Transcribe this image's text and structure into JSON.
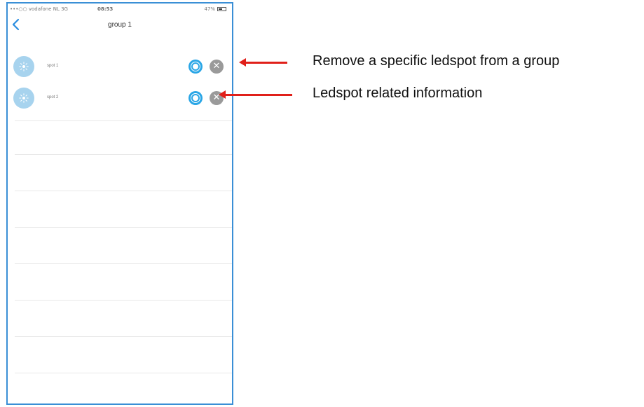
{
  "status_bar": {
    "carrier": "•••○○ vodafone NL  3G",
    "time": "08:53",
    "battery": "47%"
  },
  "nav": {
    "title": "group 1",
    "back_icon": "chevron-left-icon"
  },
  "items": [
    {
      "label": "spot 1"
    },
    {
      "label": "spot 2"
    }
  ],
  "annotations": {
    "remove": "Remove a specific ledspot from a group",
    "info": "Ledspot related information"
  },
  "colors": {
    "accent": "#2aa6e6",
    "arrow": "#e0201a",
    "frame": "#3a8fd6"
  }
}
